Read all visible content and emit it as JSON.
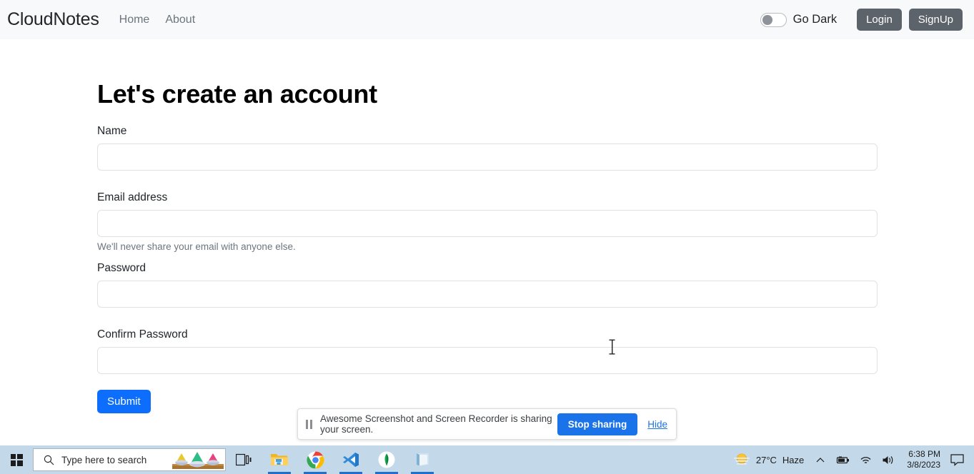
{
  "navbar": {
    "brand": "CloudNotes",
    "links": [
      {
        "label": "Home"
      },
      {
        "label": "About"
      }
    ],
    "theme_toggle": {
      "label": "Go Dark",
      "state": "off"
    },
    "buttons": [
      {
        "label": "Login"
      },
      {
        "label": "SignUp"
      }
    ],
    "background_color": "#f8f9fa",
    "button_color": "#5c636a"
  },
  "form": {
    "title": "Let's create an account",
    "fields": [
      {
        "label": "Name",
        "value": "",
        "placeholder": "",
        "help": ""
      },
      {
        "label": "Email address",
        "value": "",
        "placeholder": "",
        "help": "We'll never share your email with anyone else."
      },
      {
        "label": "Password",
        "value": "",
        "placeholder": "",
        "help": ""
      },
      {
        "label": "Confirm Password",
        "value": "",
        "placeholder": "",
        "help": ""
      }
    ],
    "submit_label": "Submit",
    "submit_color": "#0d6efd"
  },
  "share_bar": {
    "message": "Awesome Screenshot and Screen Recorder is sharing your screen.",
    "stop_label": "Stop sharing",
    "hide_label": "Hide",
    "accent_color": "#1a73e8"
  },
  "taskbar": {
    "search_placeholder": "Type here to search",
    "apps": [
      {
        "name": "task-view",
        "active": false
      },
      {
        "name": "file-explorer",
        "active": true
      },
      {
        "name": "google-chrome",
        "active": true
      },
      {
        "name": "visual-studio-code",
        "active": true
      },
      {
        "name": "mongodb-compass",
        "active": true
      },
      {
        "name": "notepad",
        "active": true
      }
    ],
    "weather": {
      "temperature": "27°C",
      "condition": "Haze"
    },
    "clock": {
      "time": "6:38 PM",
      "date": "3/8/2023"
    },
    "background_color": "#c3d8e8"
  }
}
